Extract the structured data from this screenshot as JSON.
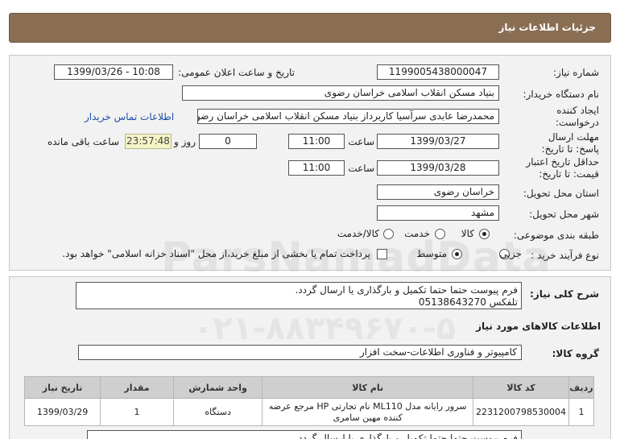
{
  "header": {
    "title": "جزئیات اطلاعات نیاز"
  },
  "form": {
    "need_number_label": "شماره نیاز:",
    "need_number": "1199005438000047",
    "announce_label": "تاریخ و ساعت اعلان عمومی:",
    "announce_value": "1399/03/26 - 10:08",
    "buyer_label": "نام دستگاه خریدار:",
    "buyer_value": "بنیاد مسکن انقلاب اسلامی خراسان رضوی",
    "creator_label": "ایجاد کننده درخواست:",
    "creator_value": "محمدرضا عابدی سرآسیا کاربرداز بنیاد مسکن انقلاب اسلامی خراسان رضوی",
    "contact_link": "اطلاعات تماس خریدار",
    "deadline_label": "مهلت ارسال پاسخ: تا تاریخ:",
    "deadline_date": "1399/03/27",
    "time_label": "ساعت",
    "deadline_time": "11:00",
    "days_value": "0",
    "days_label": "روز و",
    "remaining_timer": "23:57:48",
    "remaining_label": "ساعت باقی مانده",
    "validity_label": "حداقل تاریخ اعتبار قیمت: تا تاریخ:",
    "validity_date": "1399/03/28",
    "validity_time": "11:00",
    "province_label": "استان محل تحویل:",
    "province_value": "خراسان رضوی",
    "city_label": "شهر محل تحویل:",
    "city_value": "مشهد",
    "category_label": "طبقه بندی موضوعی:",
    "category_options": [
      "کالا",
      "خدمت",
      "کالا/خدمت"
    ],
    "category_selected": "کالا",
    "process_label": "نوع فرآیند خرید :",
    "process_options": [
      "جزیی",
      "متوسط"
    ],
    "process_selected": "متوسط",
    "payment_note": "پرداخت تمام یا بخشی از مبلغ خرید،از محل \"اسناد خزانه اسلامی\" خواهد بود."
  },
  "details": {
    "desc_label": "شرح کلی نیاز:",
    "desc_line1": "فرم پیوست حتما حتما تکمیل و بارگذاری یا ارسال گردد.",
    "desc_line2": "تلفکس 05138643270",
    "goods_info_title": "اطلاعات کالاهای مورد نیاز",
    "group_label": "گروه کالا:",
    "group_value": "کامپیوتر و فناوری اطلاعات-سخت افزار",
    "table_headers": [
      "ردیف",
      "کد کالا",
      "نام کالا",
      "واحد شمارش",
      "مقدار",
      "تاریخ نیاز"
    ],
    "rows": [
      {
        "row": "1",
        "code": "2231200798530004",
        "name": "سرور رایانه مدل ML110 نام تجارتی HP مرجع عرضه کننده مهین سامری",
        "unit": "دستگاه",
        "qty": "1",
        "date": "1399/03/29"
      }
    ],
    "desc_repeat": "فرم پیوست حتما حتما تکمیل و بارگذاری یا ارسال گردد."
  },
  "watermark": {
    "line1": "ParsNamadData",
    "line2": "پایگاه اطلاع رسانی مناقصه و مزایده",
    "line3": "۰۲۱-۸۸۳۴۹۶۷۰-۵"
  }
}
